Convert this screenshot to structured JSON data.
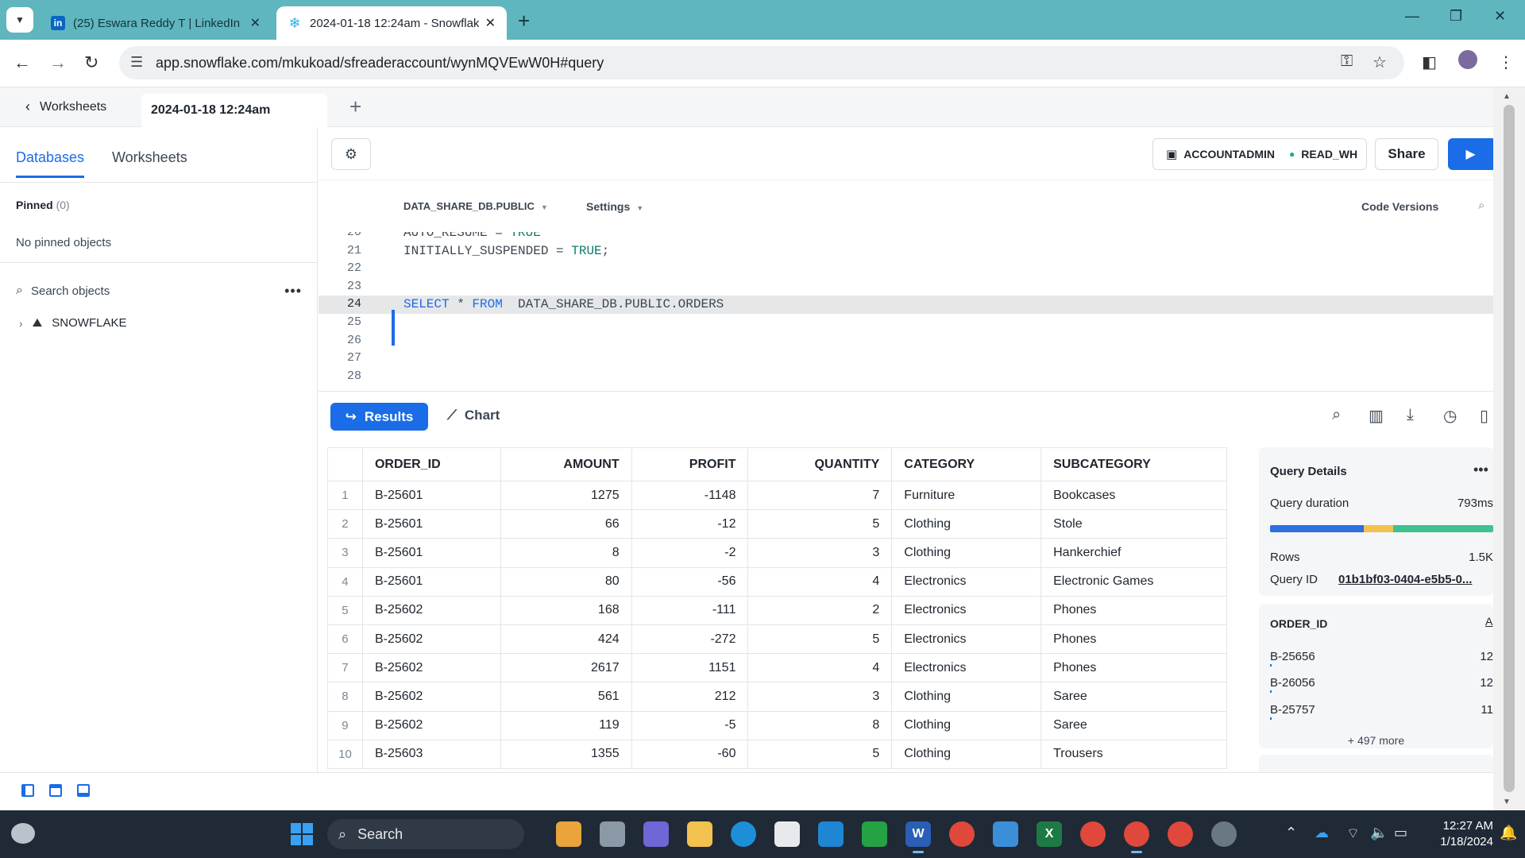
{
  "browser": {
    "tabs": [
      {
        "title": "(25) Eswara Reddy T | LinkedIn",
        "favicon": "linkedin-icon",
        "active": false
      },
      {
        "title": "2024-01-18 12:24am - Snowflake",
        "favicon": "snowflake-icon",
        "active": true
      }
    ],
    "url": "app.snowflake.com/mkukoad/sfreaderaccount/wynMQVEwW0H#query",
    "colors": {
      "tabstrip": "#5fb6bf",
      "accent": "#1a6ce7"
    }
  },
  "worksheet_header": {
    "back_label": "Worksheets",
    "active_tab": "2024-01-18 12:24am"
  },
  "sidebar": {
    "tabs": [
      {
        "label": "Databases",
        "active": true
      },
      {
        "label": "Worksheets",
        "active": false
      }
    ],
    "pinned_label": "Pinned",
    "pinned_count": "(0)",
    "no_pinned": "No pinned objects",
    "search_placeholder": "Search objects",
    "databases": [
      {
        "name": "SNOWFLAKE"
      }
    ]
  },
  "toolbar": {
    "role": "ACCOUNTADMIN",
    "warehouse": "READ_WH",
    "share_label": "Share"
  },
  "editor": {
    "context": "DATA_SHARE_DB.PUBLIC",
    "settings_label": "Settings",
    "code_versions_label": "Code Versions",
    "lines": [
      {
        "n": "20",
        "text": "AUTO_RESUME = TRUE"
      },
      {
        "n": "21",
        "text": "INITIALLY_SUSPENDED = TRUE;"
      },
      {
        "n": "22",
        "text": ""
      },
      {
        "n": "23",
        "text": ""
      },
      {
        "n": "24",
        "text": "SELECT * FROM  DATA_SHARE_DB.PUBLIC.ORDERS"
      },
      {
        "n": "25",
        "text": ""
      },
      {
        "n": "26",
        "text": ""
      },
      {
        "n": "27",
        "text": ""
      },
      {
        "n": "28",
        "text": ""
      }
    ]
  },
  "results": {
    "results_label": "Results",
    "chart_label": "Chart",
    "columns": [
      "ORDER_ID",
      "AMOUNT",
      "PROFIT",
      "QUANTITY",
      "CATEGORY",
      "SUBCATEGORY"
    ],
    "rows": [
      {
        "n": "1",
        "order_id": "B-25601",
        "amount": "1275",
        "profit": "-1148",
        "quantity": "7",
        "category": "Furniture",
        "subcategory": "Bookcases"
      },
      {
        "n": "2",
        "order_id": "B-25601",
        "amount": "66",
        "profit": "-12",
        "quantity": "5",
        "category": "Clothing",
        "subcategory": "Stole"
      },
      {
        "n": "3",
        "order_id": "B-25601",
        "amount": "8",
        "profit": "-2",
        "quantity": "3",
        "category": "Clothing",
        "subcategory": "Hankerchief"
      },
      {
        "n": "4",
        "order_id": "B-25601",
        "amount": "80",
        "profit": "-56",
        "quantity": "4",
        "category": "Electronics",
        "subcategory": "Electronic Games"
      },
      {
        "n": "5",
        "order_id": "B-25602",
        "amount": "168",
        "profit": "-111",
        "quantity": "2",
        "category": "Electronics",
        "subcategory": "Phones"
      },
      {
        "n": "6",
        "order_id": "B-25602",
        "amount": "424",
        "profit": "-272",
        "quantity": "5",
        "category": "Electronics",
        "subcategory": "Phones"
      },
      {
        "n": "7",
        "order_id": "B-25602",
        "amount": "2617",
        "profit": "1151",
        "quantity": "4",
        "category": "Electronics",
        "subcategory": "Phones"
      },
      {
        "n": "8",
        "order_id": "B-25602",
        "amount": "561",
        "profit": "212",
        "quantity": "3",
        "category": "Clothing",
        "subcategory": "Saree"
      },
      {
        "n": "9",
        "order_id": "B-25602",
        "amount": "119",
        "profit": "-5",
        "quantity": "8",
        "category": "Clothing",
        "subcategory": "Saree"
      },
      {
        "n": "10",
        "order_id": "B-25603",
        "amount": "1355",
        "profit": "-60",
        "quantity": "5",
        "category": "Clothing",
        "subcategory": "Trousers"
      }
    ]
  },
  "query_details": {
    "title": "Query Details",
    "duration_label": "Query duration",
    "duration_value": "793ms",
    "duration_breakdown": [
      {
        "share": 0.42,
        "color": "#2f6fde"
      },
      {
        "share": 0.13,
        "color": "#f2c14e"
      },
      {
        "share": 0.45,
        "color": "#3ec28f"
      }
    ],
    "rows_label": "Rows",
    "rows_value": "1.5K",
    "query_id_label": "Query ID",
    "query_id_value": "01b1bf03-0404-e5b5-0..."
  },
  "column_panel": {
    "column": "ORDER_ID",
    "type_label": "A",
    "values": [
      {
        "value": "B-25656",
        "count": "12"
      },
      {
        "value": "B-26056",
        "count": "12"
      },
      {
        "value": "B-25757",
        "count": "11"
      }
    ],
    "more_label": "+ 497 more"
  },
  "taskbar": {
    "search_label": "Search",
    "time": "12:27 AM",
    "date": "1/18/2024"
  }
}
